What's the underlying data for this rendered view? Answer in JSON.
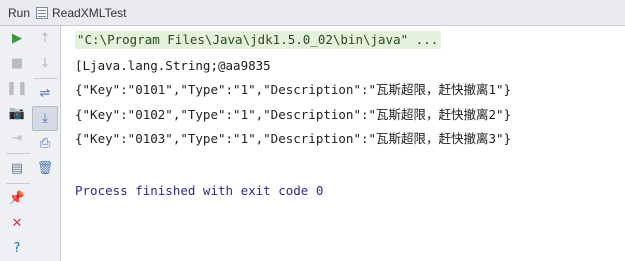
{
  "header": {
    "run_label": "Run",
    "config_name": "ReadXMLTest"
  },
  "toolbar": {
    "left": [
      {
        "name": "rerun-icon",
        "glyph": "▶",
        "color": "#3a9a3a"
      },
      {
        "name": "stop-icon",
        "glyph": "■",
        "color": "#b8bcc2"
      },
      {
        "name": "pause-icon",
        "glyph": "❚❚",
        "color": "#b8bcc2"
      },
      {
        "name": "dump-threads-icon",
        "glyph": "📷",
        "color": "#b8bcc2"
      },
      {
        "name": "exit-icon",
        "glyph": "⇥",
        "color": "#b8bcc2"
      },
      {
        "name": "layout-icon",
        "glyph": "▤",
        "color": "#6a7f96"
      },
      {
        "name": "pin-icon",
        "glyph": "📌",
        "color": "#6b4aa5"
      },
      {
        "name": "close-icon",
        "glyph": "✕",
        "color": "#d23a3a"
      },
      {
        "name": "help-icon",
        "glyph": "?",
        "color": "#2f6db5"
      }
    ],
    "right": [
      {
        "name": "up-arrow-icon",
        "glyph": "↑",
        "color": "#b8bcc2"
      },
      {
        "name": "down-arrow-icon",
        "glyph": "↓",
        "color": "#b8bcc2"
      },
      {
        "name": "soft-wrap-icon",
        "glyph": "⇌",
        "color": "#4a79b0"
      },
      {
        "name": "scroll-to-end-icon",
        "glyph": "⤓",
        "color": "#4a79b0"
      },
      {
        "name": "print-icon",
        "glyph": "⎙",
        "color": "#4a79b0"
      },
      {
        "name": "trash-icon",
        "glyph": "🗑",
        "color": "#4a79b0"
      }
    ]
  },
  "console": {
    "command": "\"C:\\Program Files\\Java\\jdk1.5.0_02\\bin\\java\" ...",
    "lines": [
      "[Ljava.lang.String;@aa9835",
      "{\"Key\":\"0101\",\"Type\":\"1\",\"Description\":\"瓦斯超限，赶快撤离1\"}",
      "{\"Key\":\"0102\",\"Type\":\"1\",\"Description\":\"瓦斯超限，赶快撤离2\"}",
      "{\"Key\":\"0103\",\"Type\":\"1\",\"Description\":\"瓦斯超限，赶快撤离3\"}"
    ],
    "exit_message": "Process finished with exit code 0"
  }
}
